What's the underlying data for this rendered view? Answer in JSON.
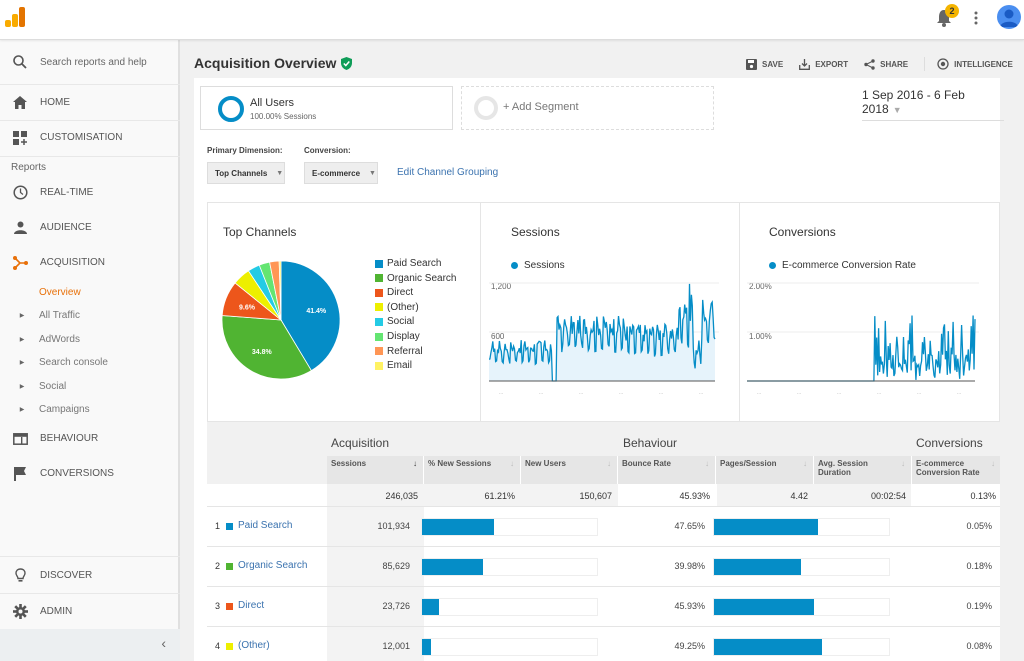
{
  "topbar": {
    "notification_count": "2"
  },
  "sidebar": {
    "search_placeholder": "Search reports and help",
    "home": "HOME",
    "customisation": "CUSTOMISATION",
    "reports_label": "Reports",
    "realtime": "REAL-TIME",
    "audience": "AUDIENCE",
    "acquisition": "ACQUISITION",
    "acquisition_sub": [
      "Overview",
      "All Traffic",
      "AdWords",
      "Search console",
      "Social",
      "Campaigns"
    ],
    "behaviour": "BEHAVIOUR",
    "conversions": "CONVERSIONS",
    "discover": "DISCOVER",
    "admin": "ADMIN",
    "collapse": "‹",
    "active_color": "#e8710a"
  },
  "header": {
    "title": "Acquisition Overview",
    "actions": {
      "save": "SAVE",
      "export": "EXPORT",
      "share": "SHARE",
      "intelligence": "INTELLIGENCE"
    }
  },
  "segments": {
    "seg1_name": "All Users",
    "seg1_sub": "100.00% Sessions",
    "add_segment": "+ Add Segment"
  },
  "date_range": "1 Sep 2016 - 6 Feb 2018",
  "controls": {
    "primary_dimension_label": "Primary Dimension:",
    "primary_dimension_value": "Top Channels",
    "conversion_label": "Conversion:",
    "conversion_value": "E-commerce",
    "edit_grouping": "Edit Channel Grouping"
  },
  "chart_data": [
    {
      "type": "pie",
      "title": "Top Channels",
      "categories": [
        "Paid Search",
        "Organic Search",
        "Direct",
        "(Other)",
        "Social",
        "Display",
        "Referral",
        "Email"
      ],
      "values": [
        41.4,
        34.8,
        9.6,
        4.9,
        3.3,
        2.9,
        2.6,
        0.5
      ],
      "colors": [
        "#058dc7",
        "#50b432",
        "#ed561b",
        "#edef00",
        "#24cbe5",
        "#64e572",
        "#ff9655",
        "#fff263"
      ],
      "data_labels": [
        "41.4%",
        "34.8%",
        "9.6%",
        "",
        "",
        "",
        "",
        ""
      ],
      "legend": "right"
    },
    {
      "type": "area",
      "title": "Sessions",
      "series": [
        {
          "name": "Sessions",
          "color": "#058dc7"
        }
      ],
      "yticks": [
        "1,200",
        "600"
      ],
      "ylim": [
        0,
        1200
      ],
      "x_range": [
        "1 Sep 2016",
        "6 Feb 2018"
      ],
      "trend_segments": [
        {
          "from": 0.0,
          "to": 0.28,
          "low": 200,
          "high": 500
        },
        {
          "from": 0.28,
          "to": 0.3,
          "low": 0,
          "high": 0
        },
        {
          "from": 0.3,
          "to": 0.6,
          "low": 350,
          "high": 800
        },
        {
          "from": 0.6,
          "to": 0.84,
          "low": 300,
          "high": 700
        },
        {
          "from": 0.84,
          "to": 0.9,
          "low": 350,
          "high": 1200
        },
        {
          "from": 0.9,
          "to": 0.94,
          "low": 150,
          "high": 500
        },
        {
          "from": 0.94,
          "to": 1.0,
          "low": 400,
          "high": 1000
        }
      ]
    },
    {
      "type": "line",
      "title": "Conversions",
      "series": [
        {
          "name": "E-commerce Conversion Rate",
          "color": "#058dc7"
        }
      ],
      "yticks": [
        "2.00%",
        "1.00%"
      ],
      "ylim": [
        0,
        2.0
      ],
      "x_range": [
        "1 Sep 2016",
        "6 Feb 2018"
      ],
      "trend_segments": [
        {
          "from": 0.0,
          "to": 0.56,
          "low": 0,
          "high": 0
        },
        {
          "from": 0.56,
          "to": 1.0,
          "low": 0,
          "high": 1.5
        }
      ]
    }
  ],
  "table": {
    "groups": {
      "acquisition": "Acquisition",
      "behaviour": "Behaviour",
      "conversions": "Conversions"
    },
    "columns": [
      "Sessions",
      "% New Sessions",
      "New Users",
      "Bounce Rate",
      "Pages/Session",
      "Avg. Session Duration",
      "E-commerce Conversion Rate"
    ],
    "totals": [
      "246,035",
      "61.21%",
      "150,607",
      "45.93%",
      "4.42",
      "00:02:54",
      "0.13%"
    ],
    "rows": [
      {
        "rank": "1",
        "channel": "Paid Search",
        "color": "#058dc7",
        "sessions": "101,934",
        "sessions_share": 0.414,
        "bounce_rate": "47.65%",
        "bounce_share": 0.4765,
        "conv_rate": "0.05%"
      },
      {
        "rank": "2",
        "channel": "Organic Search",
        "color": "#50b432",
        "sessions": "85,629",
        "sessions_share": 0.348,
        "bounce_rate": "39.98%",
        "bounce_share": 0.3998,
        "conv_rate": "0.18%"
      },
      {
        "rank": "3",
        "channel": "Direct",
        "color": "#ed561b",
        "sessions": "23,726",
        "sessions_share": 0.096,
        "bounce_rate": "45.93%",
        "bounce_share": 0.4593,
        "conv_rate": "0.19%"
      },
      {
        "rank": "4",
        "channel": "(Other)",
        "color": "#edef00",
        "sessions": "12,001",
        "sessions_share": 0.049,
        "bounce_rate": "49.25%",
        "bounce_share": 0.4925,
        "conv_rate": "0.08%"
      }
    ]
  }
}
